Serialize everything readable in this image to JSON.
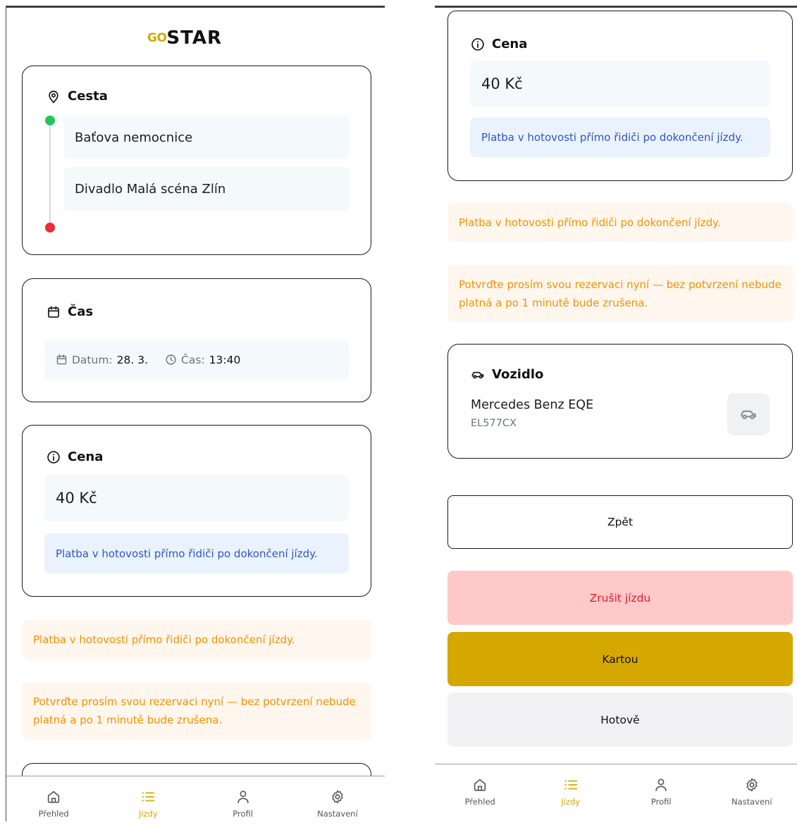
{
  "logo": {
    "go": "GO",
    "star": "STAR"
  },
  "route": {
    "title": "Cesta",
    "from": "Baťova nemocnice",
    "to": "Divadlo Malá scéna Zlín",
    "from_color": "#22c55e",
    "to_color": "#ef2b36"
  },
  "time": {
    "title": "Čas",
    "date_label": "Datum:",
    "date_value": "28. 3.",
    "time_label": "Čas:",
    "time_value": "13:40"
  },
  "price": {
    "title": "Cena",
    "value": "40 Kč",
    "info": "Platba v hotovosti přímo řidiči po dokončení jízdy."
  },
  "notices": {
    "cash": "Platba v hotovosti přímo řidiči po dokončení jízdy.",
    "confirm": "Potvrďte prosím svou rezervaci nyní — bez potvrzení nebude platná a po 1 minutě bude zrušena."
  },
  "vehicle": {
    "title": "Vozidlo",
    "model": "Mercedes Benz EQE",
    "plate": "EL577CX"
  },
  "buttons": {
    "back": "Zpět",
    "cancel": "Zrušit jízdu",
    "card": "Kartou",
    "cash": "Hotově"
  },
  "colors": {
    "accent": "#d4a800",
    "cancel_bg": "#ffc9c9",
    "cancel_text": "#e11d2b",
    "info_blue": "#2f56c4",
    "notice_orange": "#f39200"
  },
  "nav": [
    {
      "label": "Přehled",
      "icon": "home-icon"
    },
    {
      "label": "Jízdy",
      "icon": "list-icon",
      "active": true
    },
    {
      "label": "Profil",
      "icon": "user-icon"
    },
    {
      "label": "Nastavení",
      "icon": "gear-icon"
    }
  ]
}
